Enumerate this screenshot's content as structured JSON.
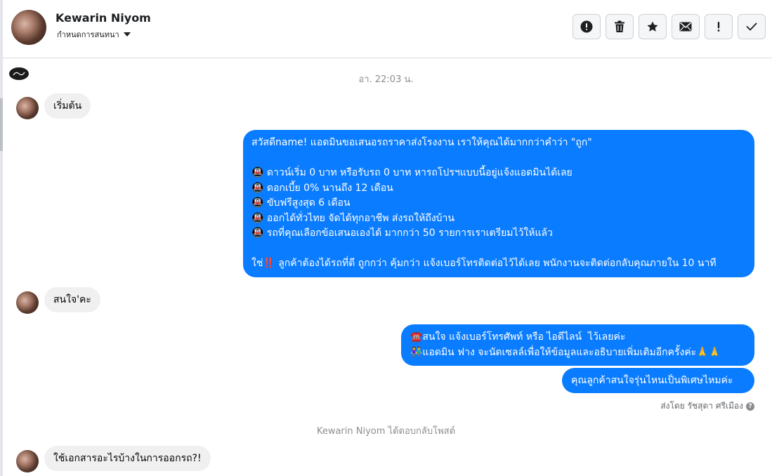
{
  "header": {
    "user_name": "Kewarin Niyom",
    "assign_label": "กำหนดการสนทนา",
    "actions": [
      {
        "name": "spam",
        "icon": "alert-circle-icon"
      },
      {
        "name": "delete",
        "icon": "trash-icon"
      },
      {
        "name": "star",
        "icon": "star-icon"
      },
      {
        "name": "mark-unread",
        "icon": "envelope-icon"
      },
      {
        "name": "follow-up",
        "icon": "exclamation-icon"
      },
      {
        "name": "done",
        "icon": "check-icon"
      }
    ]
  },
  "chat": {
    "timestamp": "อา. 22:03 น.",
    "messages": [
      {
        "from": "customer",
        "text": "เริ่มต้น"
      },
      {
        "from": "page",
        "text": "สวัสดีname! แอดมินขอเสนอรถราคาส่งโรงงาน เราให้คุณได้มากกว่าคำว่า \"ถูก\"\n\n🚇 ดาวน์เริ่ม 0 บาท หรือรับรถ 0 บาท หารถโปรฯแบบนี้อยู่แจ้งแอดมินได้เลย\n🚇 ดอกเบี้ย 0% นานถึง 12 เดือน\n🚇 ขับฟรีสูงสุด 6 เดือน\n🚇 ออกได้ทั่วไทย จัดได้ทุกอาชีพ ส่งรถให้ถึงบ้าน\n🚇 รถที่คุณเลือกข้อเสนอเองได้ มากกว่า 50 รายการเราเตรียมไว้ให้แล้ว\n\nใช่‼️ ลูกค้าต้องได้รถที่ดี ถูกกว่า คุ้มกว่า แจ้งเบอร์โทรติดต่อไว้ได้เลย พนักงานจะติดต่อกลับคุณภายใน 10 นาที"
      },
      {
        "from": "customer",
        "text": "สนใจ'คะ"
      },
      {
        "from": "page",
        "text": "☎️สนใจ แจ้งเบอร์โทรศัพท์ หรือ ไอดีไลน์  ไว้เลยค่ะ\n👫แอดมิน ฟาง จะนัดเซลล์เพื่อให้ข้อมูลและอธิบายเพิ่มเติมอีกครั้งค่ะ🙏🙏"
      },
      {
        "from": "page",
        "text": "คุณลูกค้าสนใจรุ่นไหนเป็นพิเศษไหมค่ะ"
      },
      {
        "from": "customer",
        "text": "ใช้เอกสารอะไรบ้างในการออกรถ?!"
      }
    ],
    "sent_by": "ส่งโดย รัชสุดา ศรีเมือง",
    "reply_note": "Kewarin Niyom ได้ตอบกลับโพสต์"
  },
  "colors": {
    "outgoing_bubble": "#0a7cff",
    "incoming_bubble": "#f0f0f0",
    "meta_text": "#8a8d91"
  }
}
